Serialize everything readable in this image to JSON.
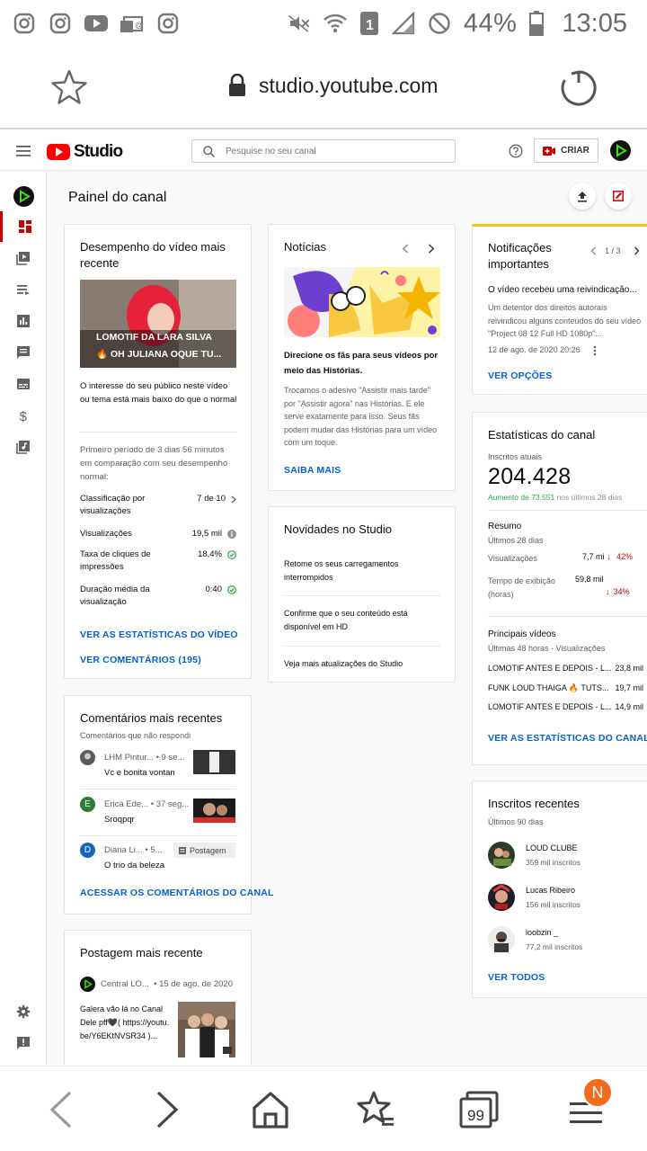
{
  "status_bar": {
    "battery": "44%",
    "time": "13:05",
    "sim": "1"
  },
  "browser": {
    "url": "studio.youtube.com"
  },
  "studio": {
    "logo_text": "Studio",
    "search_placeholder": "Pesquise no seu canal",
    "create_label": "CRIAR"
  },
  "page": {
    "title": "Painel do canal"
  },
  "video_perf": {
    "title": "Desempenho do vídeo mais recente",
    "thumb_line1": "LOMOTIF DA LARA SILVA",
    "thumb_line2": "🔥 OH JULIANA OQUE TU...",
    "summary": "O interesse do seu público neste vídeo ou tema está mais baixo do que o normal",
    "period": "Primeiro período de 3 dias 56 minutos em comparação com seu desempenho normal:",
    "rows": [
      {
        "label": "Classificação por visualizações",
        "value": "7 de 10"
      },
      {
        "label": "Visualizações",
        "value": "19,5 mil"
      },
      {
        "label": "Taxa de cliques de impressões",
        "value": "18,4%"
      },
      {
        "label": "Duração média da visualização",
        "value": "0:40"
      }
    ],
    "link_stats": "VER AS ESTATÍSTICAS DO VÍDEO",
    "link_comments": "VER COMENTÁRIOS (195)"
  },
  "news": {
    "title": "Notícias",
    "headline": "Direcione os fãs para seus vídeos por meio das Histórias.",
    "body": "Trocamos o adesivo \"Assistir mais tarde\" por \"Assistir agora\" nas Histórias. E ele serve exatamente para isso. Seus fãs podem mudar das Histórias para um vídeo com um toque.",
    "link": "SAIBA MAIS"
  },
  "studio_news": {
    "title": "Novidades no Studio",
    "items": [
      "Retome os seus carregamentos interrompidos",
      "Confirme que o seu conteúdo está disponível em HD",
      "Veja mais atualizações do Studio"
    ]
  },
  "notifications": {
    "title": "Notificações importantes",
    "pager": "1 / 3",
    "headline": "O vídeo recebeu uma reivindicação...",
    "body": "Um detentor dos direitos autorais reivindicou alguns conteúdos do seu vídeo \"Project 08 12 Full HD 1080p\"...",
    "date": "12 de ago. de 2020 20:26",
    "link": "VER OPÇÕES"
  },
  "channel_stats": {
    "title": "Estatísticas do canal",
    "subs_label": "Inscritos atuais",
    "subs_value": "204.428",
    "subs_change": "Aumento de 73.551",
    "subs_change_suffix": "nos últimos 28 dias",
    "summary_title": "Resumo",
    "summary_period": "Últimos 28 dias",
    "views_label": "Visualizações",
    "views_value": "7,7 mi",
    "views_change": "42%",
    "watch_label": "Tempo de exibição (horas)",
    "watch_value": "59,8 mil",
    "watch_change": "34%",
    "top_title": "Principais vídeos",
    "top_period": "Últimas 48 horas · Visualizações",
    "top_videos": [
      {
        "title": "LOMOTIF ANTES E DEPOIS - L...",
        "views": "23,8 mil"
      },
      {
        "title": "FUNK LOUD THAIGA 🔥 TUTS...",
        "views": "19,7 mil"
      },
      {
        "title": "LOMOTIF ANTES E DEPOIS - L...",
        "views": "14,9 mil"
      }
    ],
    "link": "VER AS ESTATÍSTICAS DO CANAL"
  },
  "comments": {
    "title": "Comentários mais recentes",
    "subtitle": "Comentários que não respondi",
    "items": [
      {
        "author": "LHM Pintur...",
        "time": "• 9 se...",
        "text": "Vc e bonita vontan",
        "initial": ""
      },
      {
        "author": "Erica Ede...",
        "time": "• 37 seg...",
        "text": "Sroqpqr",
        "initial": "E"
      },
      {
        "author": "Diana Li...",
        "time": "• 5...",
        "text": "O trio da beleza",
        "initial": "D",
        "tag": "Postagem"
      }
    ],
    "link": "ACESSAR OS COMENTÁRIOS DO CANAL"
  },
  "post": {
    "title": "Postagem mais recente",
    "author": "Central LO...",
    "date": "• 15 de ago. de 2020",
    "text": "Galera vão lá no Canal Dele pff🖤( https://youtu.be/Y6EKtNVSR34 )..."
  },
  "recent_subs": {
    "title": "Inscritos recentes",
    "period": "Últimos 90 dias",
    "items": [
      {
        "name": "LOUD CLUBE",
        "subs": "359 mil inscritos"
      },
      {
        "name": "Lucas Ribeiro",
        "subs": "156 mil inscritos"
      },
      {
        "name": "loobzin _",
        "subs": "77,2 mil inscritos"
      }
    ],
    "link": "VER TODOS"
  },
  "bottom_nav": {
    "tabs_count": "99",
    "badge": "N"
  },
  "colors": {
    "brand_red": "#ff0000",
    "link_blue": "#065fd4",
    "green": "#2ba640",
    "decline_red": "#cc0000",
    "notify_accent": "#f9c00c"
  }
}
